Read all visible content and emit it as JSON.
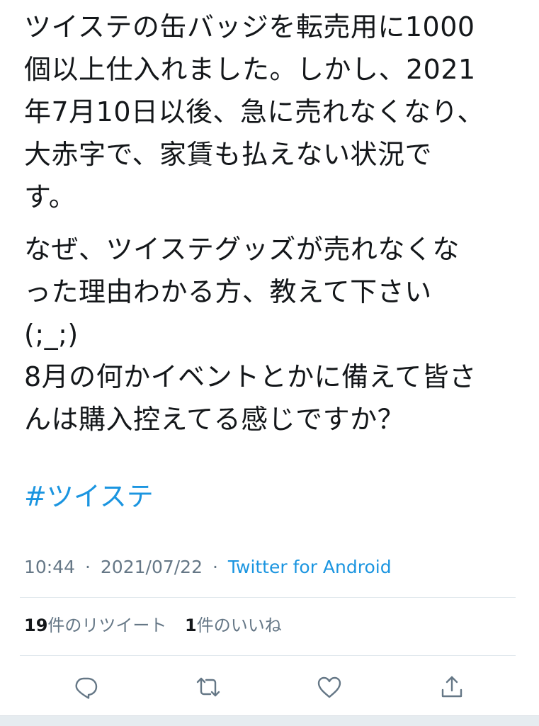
{
  "tweet": {
    "paragraphs": [
      "ツイステの缶バッジを転売用に1000\n個以上仕入れました。しかし、2021\n年7月10日以後、急に売れなくなり、\n大赤字で、家賃も払えない状況で\nす。",
      "なぜ、ツイステグッズが売れなくな\nった理由わかる方、教えて下さい\n(;_;)\n8月の何かイベントとかに備えて皆さ\nんは購入控えてる感じですか？"
    ],
    "hashtag": "#ツイステ",
    "time": "10:44",
    "date": "2021/07/22",
    "separator": "·",
    "source": "Twitter for Android",
    "stats": {
      "retweets_count": "19",
      "retweets_label": "件のリツイート",
      "likes_count": "1",
      "likes_label": "件のいいね"
    },
    "actions": [
      {
        "name": "reply",
        "icon": "reply-icon"
      },
      {
        "name": "retweet",
        "icon": "retweet-icon"
      },
      {
        "name": "like",
        "icon": "heart-icon"
      },
      {
        "name": "share",
        "icon": "share-icon"
      }
    ]
  },
  "colors": {
    "text": "#14171a",
    "secondary": "#657786",
    "link": "#1b95e0",
    "divider": "#e1e8ed"
  }
}
